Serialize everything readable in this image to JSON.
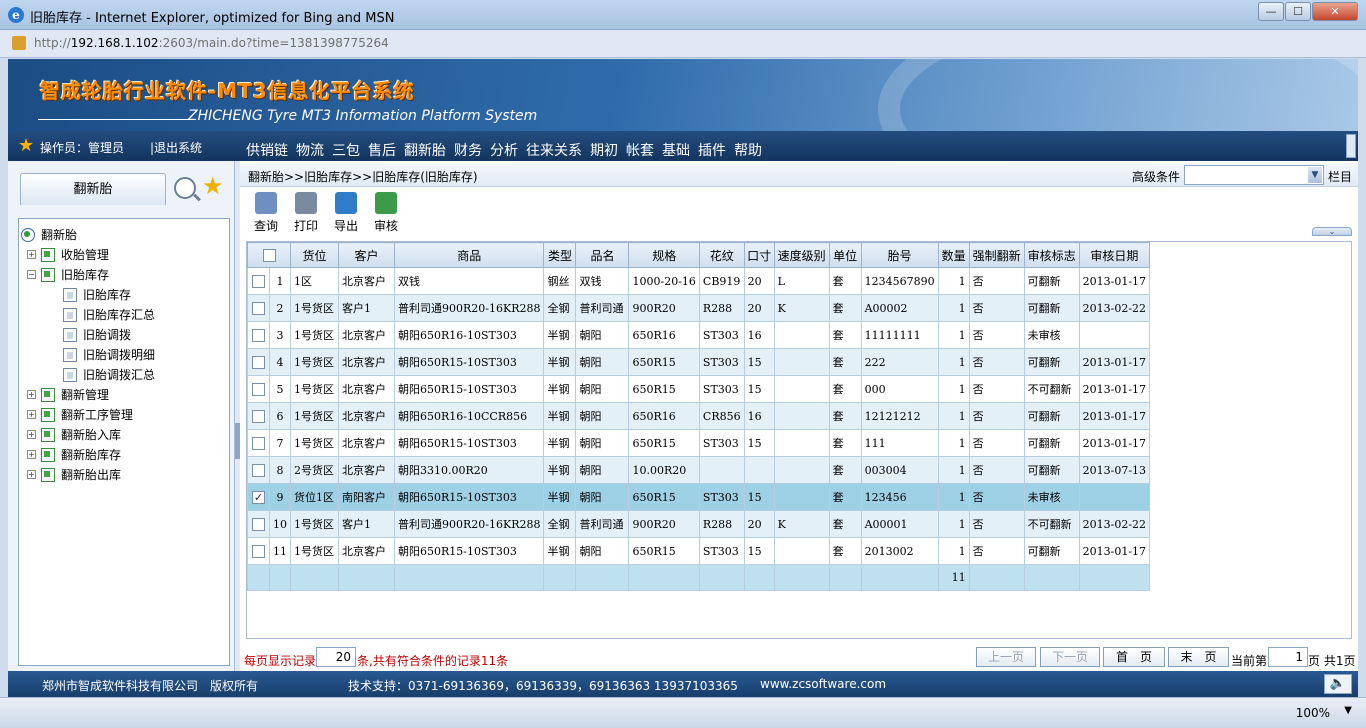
{
  "window": {
    "title": "旧胎库存 - Internet Explorer, optimized for Bing and MSN",
    "url_prefix": "http://",
    "url_host": "192.168.1.102",
    "url_rest": ":2603/main.do?time=1381398775264",
    "min": "—",
    "max": "☐",
    "close": "✕"
  },
  "banner": {
    "title": "智成轮胎行业软件-MT3信息化平台系统",
    "subtitle": "ZHICHENG Tyre  MT3 Information Platform System"
  },
  "menubar": {
    "operator": "操作员：管理员",
    "logout": "|退出系统",
    "items": [
      "供销链",
      "物流",
      "三包",
      "售后",
      "翻新胎",
      "财务",
      "分析",
      "往来关系",
      "期初",
      "帐套",
      "基础",
      "插件",
      "帮助"
    ]
  },
  "left": {
    "tab": "翻新胎",
    "tree": [
      {
        "label": "翻新胎",
        "level": 0,
        "type": "root",
        "exp": ""
      },
      {
        "label": "收胎管理",
        "level": 1,
        "type": "folder",
        "exp": "+"
      },
      {
        "label": "旧胎库存",
        "level": 1,
        "type": "folder",
        "exp": "−"
      },
      {
        "label": "旧胎库存",
        "level": 2,
        "type": "doc",
        "exp": ""
      },
      {
        "label": "旧胎库存汇总",
        "level": 2,
        "type": "doc",
        "exp": ""
      },
      {
        "label": "旧胎调拨",
        "level": 2,
        "type": "doc",
        "exp": ""
      },
      {
        "label": "旧胎调拨明细",
        "level": 2,
        "type": "doc",
        "exp": ""
      },
      {
        "label": "旧胎调拨汇总",
        "level": 2,
        "type": "doc",
        "exp": ""
      },
      {
        "label": "翻新管理",
        "level": 1,
        "type": "folder",
        "exp": "+"
      },
      {
        "label": "翻新工序管理",
        "level": 1,
        "type": "folder",
        "exp": "+"
      },
      {
        "label": "翻新胎入库",
        "level": 1,
        "type": "folder",
        "exp": "+"
      },
      {
        "label": "翻新胎库存",
        "level": 1,
        "type": "folder",
        "exp": "+"
      },
      {
        "label": "翻新胎出库",
        "level": 1,
        "type": "folder",
        "exp": "+"
      }
    ]
  },
  "main": {
    "breadcrumb": "翻新胎>>旧胎库存>>旧胎库存(旧胎库存)",
    "adv_label": "高级条件",
    "adv_value": "",
    "columns_label": "栏目",
    "toolbar": [
      {
        "label": "查询",
        "icon": "query-icon",
        "color": "#6d8fc2"
      },
      {
        "label": "打印",
        "icon": "print-icon",
        "color": "#7a8aa0"
      },
      {
        "label": "导出",
        "icon": "export-icon",
        "color": "#2f7cc9"
      },
      {
        "label": "审核",
        "icon": "audit-icon",
        "color": "#3c9a4a"
      }
    ],
    "toggle": "⌄",
    "headers": [
      "",
      "货位",
      "客户",
      "商品",
      "类型",
      "品名",
      "规格",
      "花纹",
      "口寸",
      "速度级别",
      "单位",
      "胎号",
      "数量",
      "强制翻新",
      "审核标志",
      "审核日期"
    ],
    "rows": [
      {
        "idx": "1",
        "checked": false,
        "cells": [
          "1区",
          "北京客户",
          "双钱",
          "钢丝",
          "双钱",
          "1000-20-16",
          "CB919",
          "20",
          "L",
          "套",
          "1234567890",
          "1",
          "否",
          "可翻新",
          "2013-01-17"
        ]
      },
      {
        "idx": "2",
        "checked": false,
        "cells": [
          "1号货区",
          "客户1",
          "普利司通900R20-16KR288",
          "全钢",
          "普利司通",
          "900R20",
          "R288",
          "20",
          "K",
          "套",
          "A00002",
          "1",
          "否",
          "可翻新",
          "2013-02-22"
        ]
      },
      {
        "idx": "3",
        "checked": false,
        "cells": [
          "1号货区",
          "北京客户",
          "朝阳650R16-10ST303",
          "半钢",
          "朝阳",
          "650R16",
          "ST303",
          "16",
          "",
          "套",
          "11111111",
          "1",
          "否",
          "未审核",
          ""
        ]
      },
      {
        "idx": "4",
        "checked": false,
        "cells": [
          "1号货区",
          "北京客户",
          "朝阳650R15-10ST303",
          "半钢",
          "朝阳",
          "650R15",
          "ST303",
          "15",
          "",
          "套",
          "222",
          "1",
          "否",
          "可翻新",
          "2013-01-17"
        ]
      },
      {
        "idx": "5",
        "checked": false,
        "cells": [
          "1号货区",
          "北京客户",
          "朝阳650R15-10ST303",
          "半钢",
          "朝阳",
          "650R15",
          "ST303",
          "15",
          "",
          "套",
          "000",
          "1",
          "否",
          "不可翻新",
          "2013-01-17"
        ]
      },
      {
        "idx": "6",
        "checked": false,
        "cells": [
          "1号货区",
          "北京客户",
          "朝阳650R16-10CCR856",
          "半钢",
          "朝阳",
          "650R16",
          "CR856",
          "16",
          "",
          "套",
          "12121212",
          "1",
          "否",
          "可翻新",
          "2013-01-17"
        ]
      },
      {
        "idx": "7",
        "checked": false,
        "cells": [
          "1号货区",
          "北京客户",
          "朝阳650R15-10ST303",
          "半钢",
          "朝阳",
          "650R15",
          "ST303",
          "15",
          "",
          "套",
          "111",
          "1",
          "否",
          "可翻新",
          "2013-01-17"
        ]
      },
      {
        "idx": "8",
        "checked": false,
        "cells": [
          "2号货区",
          "北京客户",
          "朝阳3310.00R20",
          "半钢",
          "朝阳",
          "10.00R20",
          "",
          "",
          "",
          "套",
          "003004",
          "1",
          "否",
          "可翻新",
          "2013-07-13"
        ]
      },
      {
        "idx": "9",
        "checked": true,
        "cells": [
          "货位1区",
          "南阳客户",
          "朝阳650R15-10ST303",
          "半钢",
          "朝阳",
          "650R15",
          "ST303",
          "15",
          "",
          "套",
          "123456",
          "1",
          "否",
          "未审核",
          ""
        ]
      },
      {
        "idx": "10",
        "checked": false,
        "cells": [
          "1号货区",
          "客户1",
          "普利司通900R20-16KR288",
          "全钢",
          "普利司通",
          "900R20",
          "R288",
          "20",
          "K",
          "套",
          "A00001",
          "1",
          "否",
          "不可翻新",
          "2013-02-22"
        ]
      },
      {
        "idx": "11",
        "checked": false,
        "cells": [
          "1号货区",
          "北京客户",
          "朝阳650R15-10ST303",
          "半钢",
          "朝阳",
          "650R15",
          "ST303",
          "15",
          "",
          "套",
          "2013002",
          "1",
          "否",
          "可翻新",
          "2013-01-17"
        ]
      }
    ],
    "sum_qty": "11",
    "pager": {
      "per_page_label": "每页显示记录",
      "per_page": "20",
      "count_text": "条,共有符合条件的记录11条",
      "prev": "上一页",
      "next": "下一页",
      "first": "首　页",
      "last": "末　页",
      "current_label": "当前第",
      "current": "1",
      "total_text": "页 共1页"
    }
  },
  "footer": {
    "company": "郑州市智成软件科技有限公司　版权所有",
    "support": "技术支持：0371-69136369，69136339，69136363  13937103365",
    "website": "www.zcsoftware.com",
    "sound": "🔈"
  },
  "status": {
    "zoom": "100%",
    "zoom_arrow": "▼"
  }
}
